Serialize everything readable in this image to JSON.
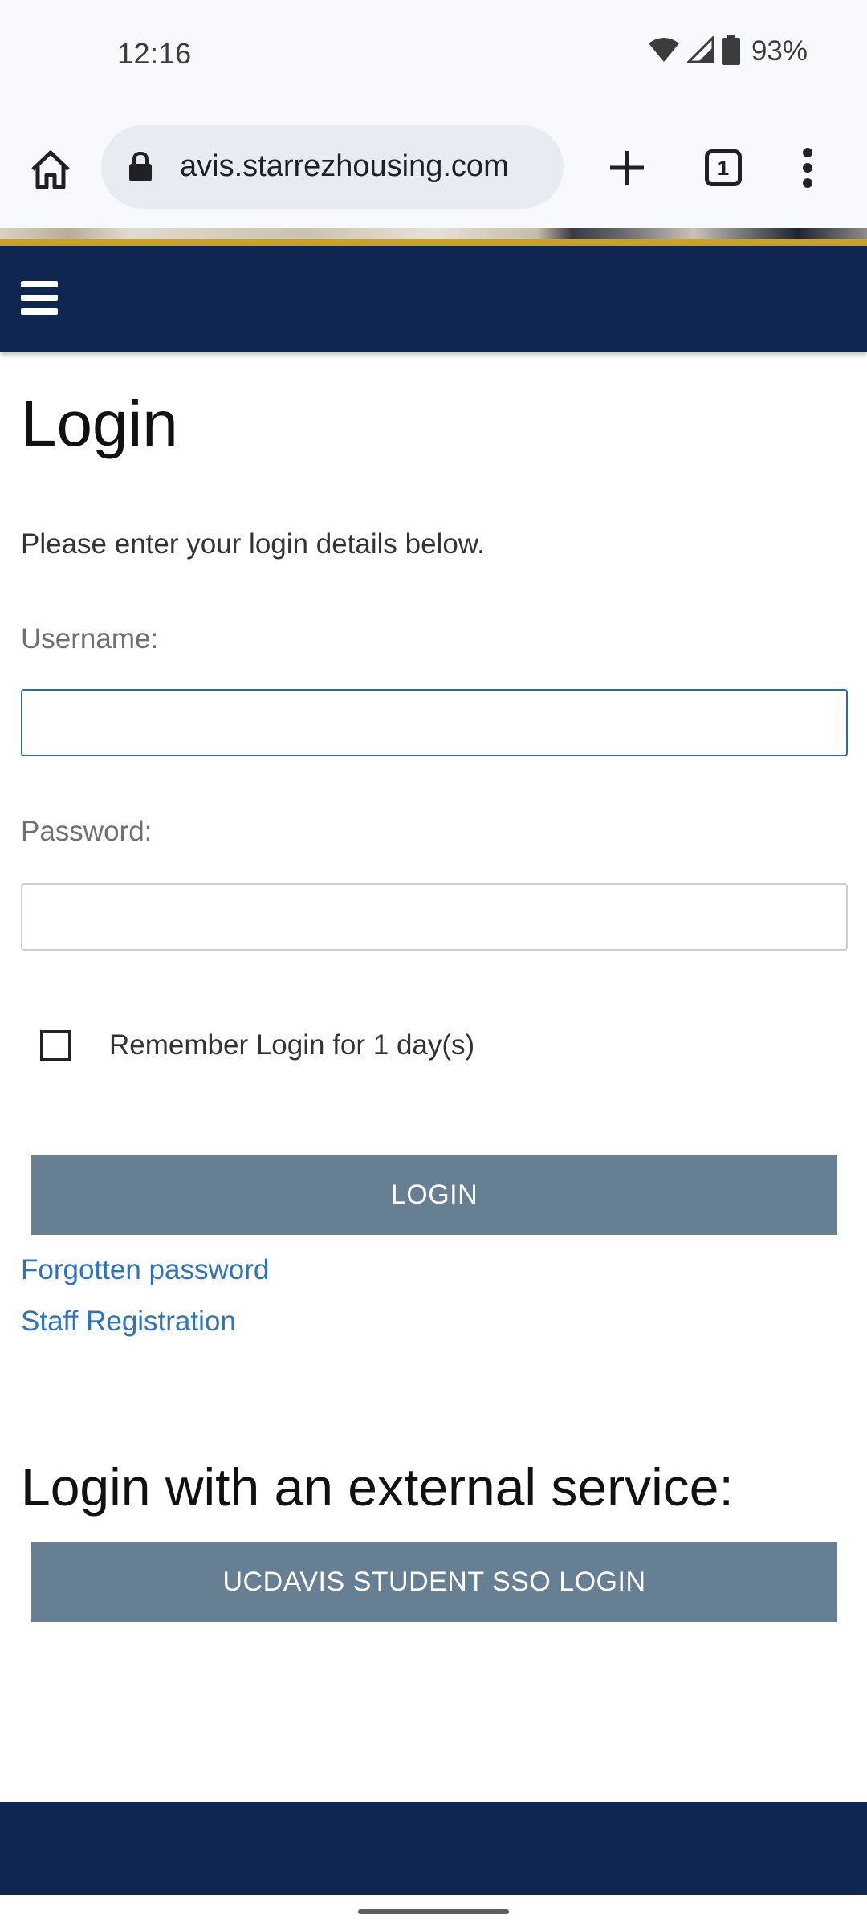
{
  "status_bar": {
    "time": "12:16",
    "battery_pct": "93%"
  },
  "browser": {
    "url": "avis.starrezhousing.com",
    "tab_count": "1",
    "icons": {
      "home": "home-icon",
      "lock": "lock-icon",
      "new_tab": "plus-icon",
      "tabs": "tab-switcher-icon",
      "menu": "more-vert-icon"
    }
  },
  "site": {
    "header_color": "#0f2650",
    "accent_color": "#c9a227"
  },
  "login": {
    "title": "Login",
    "intro": "Please enter your login details below.",
    "username_label": "Username:",
    "username_value": "",
    "password_label": "Password:",
    "password_value": "",
    "remember_label": "Remember Login for 1 day(s)",
    "remember_checked": false,
    "login_button": "LOGIN",
    "forgot_link": "Forgotten password",
    "staff_link": "Staff Registration"
  },
  "external": {
    "title": "Login with an external service:",
    "sso_button": "UCDAVIS STUDENT SSO LOGIN"
  }
}
